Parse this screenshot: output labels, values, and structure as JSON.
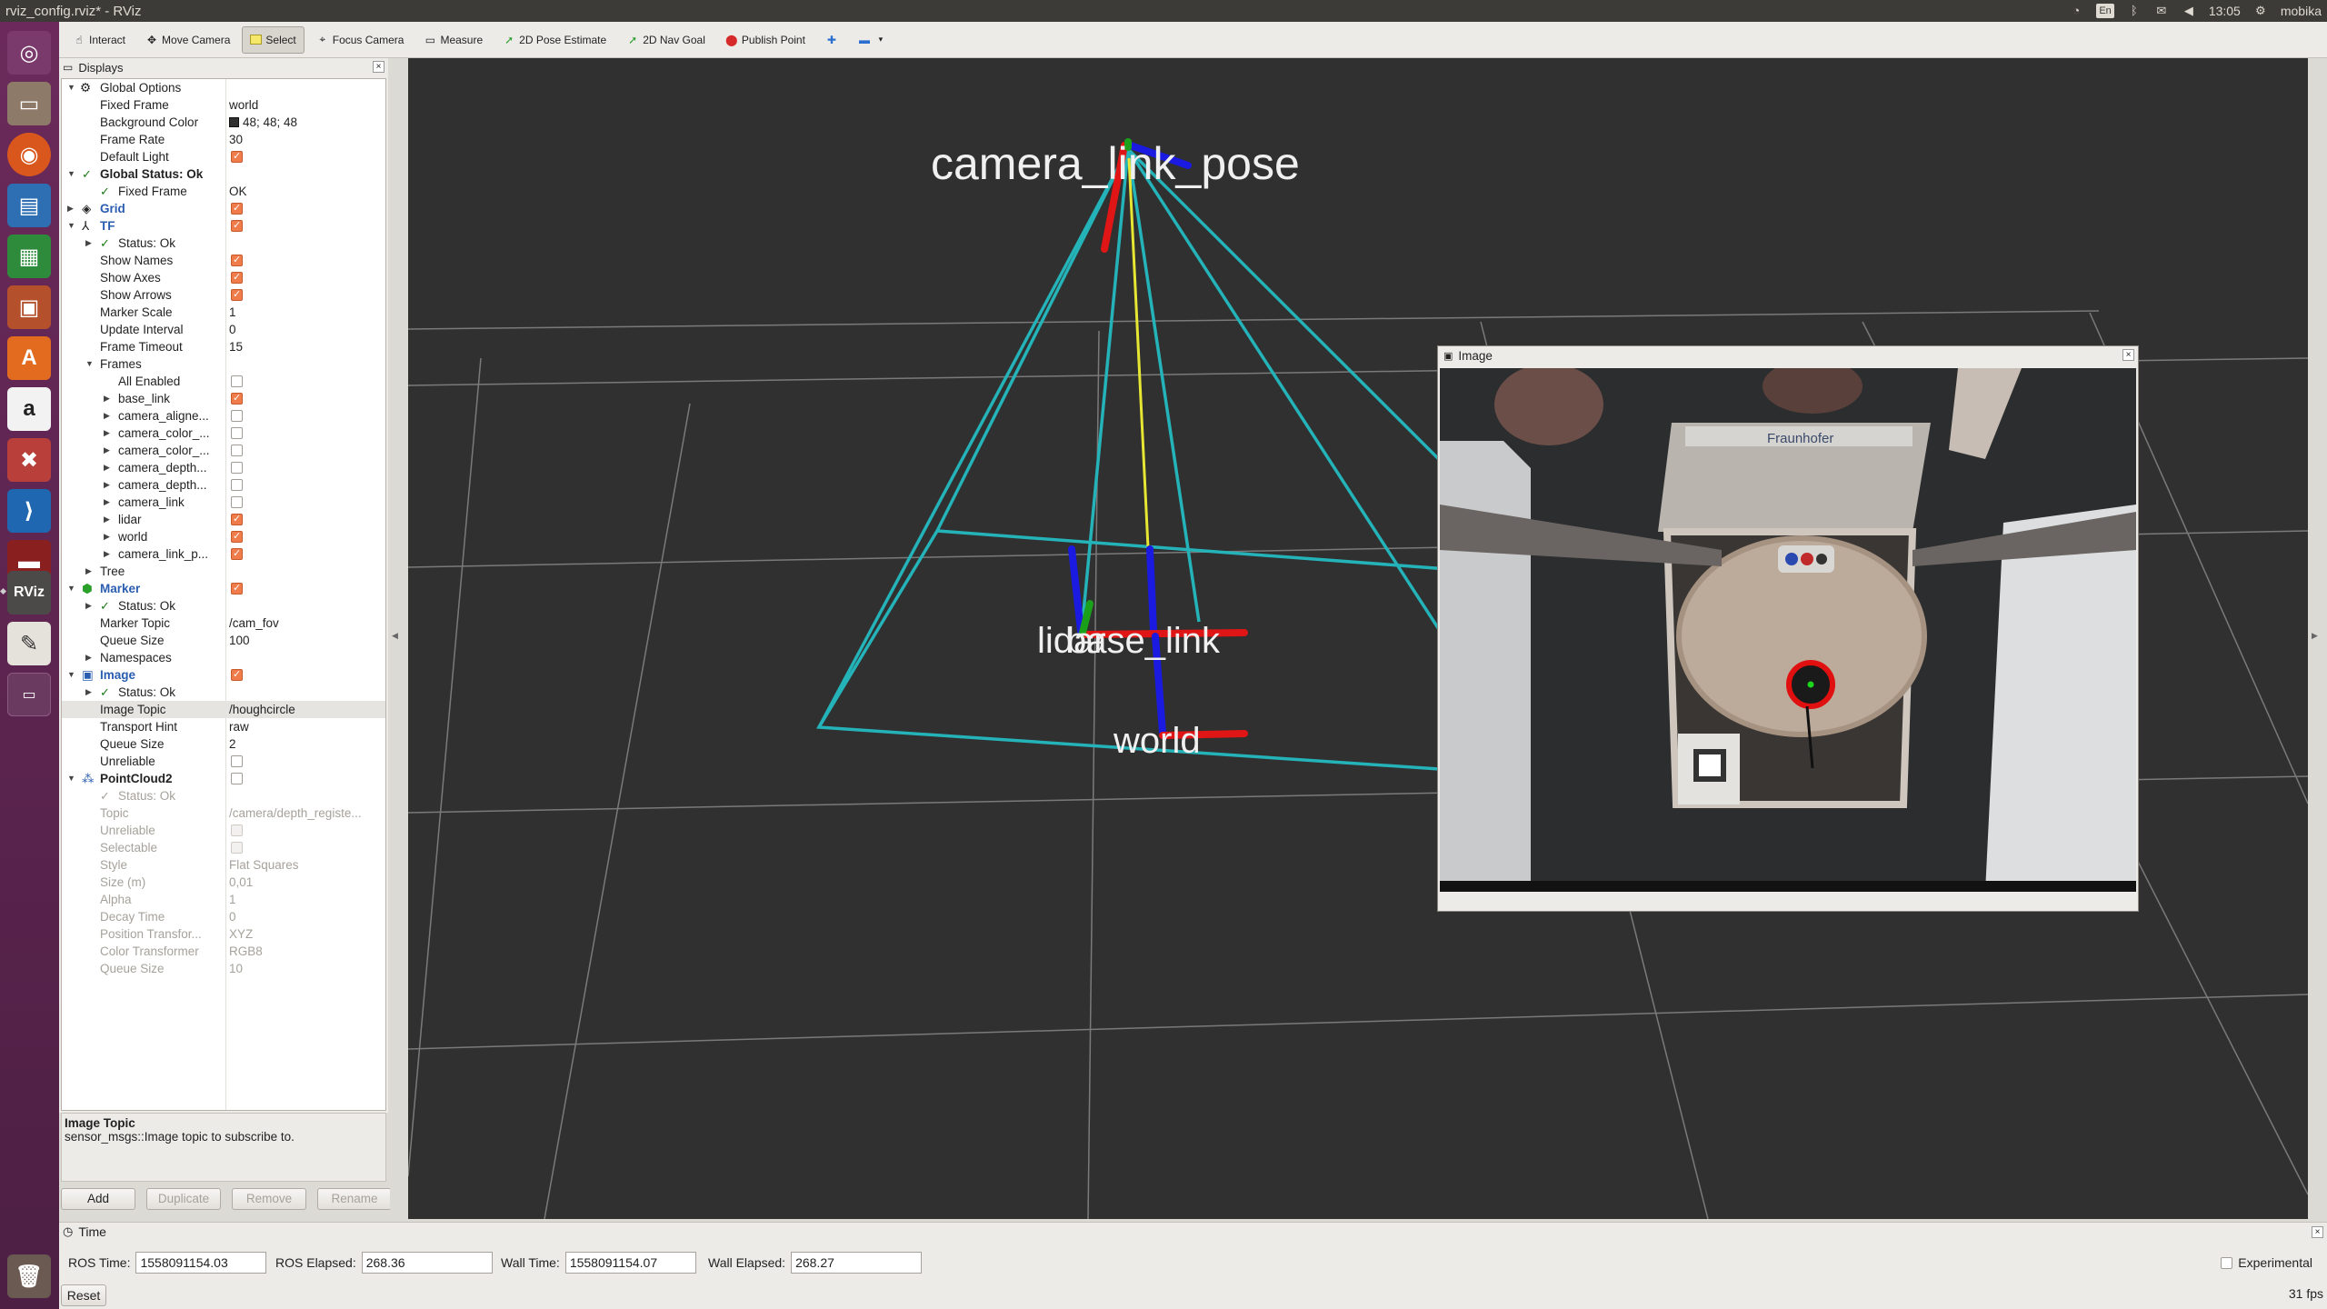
{
  "window": {
    "title": "rviz_config.rviz* - RViz"
  },
  "tray": {
    "lang": "En",
    "time": "13:05",
    "user": "mobika"
  },
  "toolbar": {
    "interact": "Interact",
    "move_camera": "Move Camera",
    "select": "Select",
    "focus_camera": "Focus Camera",
    "measure": "Measure",
    "pose_estimate": "2D Pose Estimate",
    "nav_goal": "2D Nav Goal",
    "publish_point": "Publish Point"
  },
  "displays": {
    "title": "Displays",
    "global_options": "Global Options",
    "fixed_frame_label": "Fixed Frame",
    "fixed_frame": "world",
    "bg_color_label": "Background Color",
    "bg_color": "48; 48; 48",
    "frame_rate_label": "Frame Rate",
    "frame_rate": "30",
    "default_light_label": "Default Light",
    "global_status": "Global Status: Ok",
    "fixed_frame_status_label": "Fixed Frame",
    "fixed_frame_status": "OK",
    "grid": "Grid",
    "tf": "TF",
    "status_ok": "Status: Ok",
    "show_names": "Show Names",
    "show_axes": "Show Axes",
    "show_arrows": "Show Arrows",
    "marker_scale_label": "Marker Scale",
    "marker_scale": "1",
    "update_interval_label": "Update Interval",
    "update_interval": "0",
    "frame_timeout_label": "Frame Timeout",
    "frame_timeout": "15",
    "frames": "Frames",
    "all_enabled": "All Enabled",
    "frame_items": [
      "base_link",
      "camera_aligne...",
      "camera_color_...",
      "camera_color_...",
      "camera_depth...",
      "camera_depth...",
      "camera_link",
      "lidar",
      "world",
      "camera_link_p..."
    ],
    "tree": "Tree",
    "marker": "Marker",
    "marker_topic_label": "Marker Topic",
    "marker_topic": "/cam_fov",
    "queue_size_label": "Queue Size",
    "marker_queue": "100",
    "namespaces": "Namespaces",
    "image": "Image",
    "image_topic_label": "Image Topic",
    "image_topic": "/houghcircle",
    "transport_hint_label": "Transport Hint",
    "transport_hint": "raw",
    "image_queue": "2",
    "unreliable": "Unreliable",
    "pointcloud2": "PointCloud2",
    "topic_label": "Topic",
    "pc_topic": "/camera/depth_registe...",
    "selectable": "Selectable",
    "style_label": "Style",
    "style": "Flat Squares",
    "size_label": "Size (m)",
    "size": "0,01",
    "alpha_label": "Alpha",
    "alpha": "1",
    "decay_label": "Decay Time",
    "decay": "0",
    "pos_tf_label": "Position Transfor...",
    "pos_tf": "XYZ",
    "color_tf_label": "Color Transformer",
    "color_tf": "RGB8",
    "pc_queue": "10"
  },
  "description": {
    "title": "Image Topic",
    "text": "sensor_msgs::Image topic to subscribe to."
  },
  "buttons": {
    "add": "Add",
    "duplicate": "Duplicate",
    "remove": "Remove",
    "rename": "Rename"
  },
  "view": {
    "labels": {
      "camera_link_pose": "camera_link_pose",
      "lidar": "lidar",
      "base_link": "base_link",
      "world": "world"
    }
  },
  "image_window": {
    "title": "Image"
  },
  "camera_image": {
    "brand_text": "Fraunhofer"
  },
  "time": {
    "title": "Time",
    "ros_time_label": "ROS Time:",
    "ros_time": "1558091154.03",
    "ros_elapsed_label": "ROS Elapsed:",
    "ros_elapsed": "268.36",
    "wall_time_label": "Wall Time:",
    "wall_time": "1558091154.07",
    "wall_elapsed_label": "Wall Elapsed:",
    "wall_elapsed": "268.27",
    "experimental": "Experimental",
    "reset": "Reset",
    "fps": "31 fps"
  },
  "colors": {
    "background": "#303030",
    "fov_lines": "#24b3b8",
    "accent_checkbox": "#ef7c4a",
    "launcher": "#5c2450"
  }
}
